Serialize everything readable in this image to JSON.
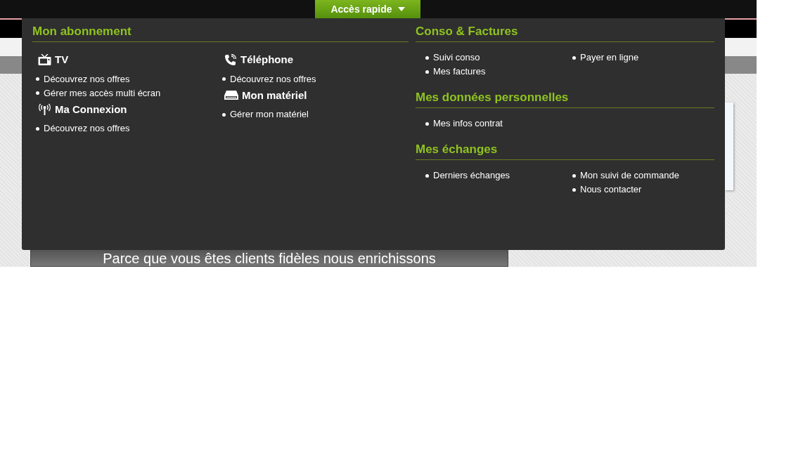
{
  "quick_access": {
    "label": "Accès rapide"
  },
  "subscription": {
    "title": "Mon abonnement",
    "columns": [
      [
        {
          "kind": "tv",
          "title": "TV",
          "links": [
            "Découvrez nos offres",
            "Gérer mes accès multi écran"
          ]
        },
        {
          "kind": "antenna",
          "title": "Ma Connexion",
          "links": [
            "Découvrez nos offres"
          ]
        }
      ],
      [
        {
          "kind": "phone",
          "title": "Téléphone",
          "links": [
            "Découvrez nos offres"
          ]
        },
        {
          "kind": "drive",
          "title": "Mon matériel",
          "links": [
            "Gérer mon matériel"
          ]
        }
      ]
    ]
  },
  "sections": [
    {
      "title": "Conso & Factures",
      "columns": [
        [
          "Suivi conso",
          "Mes factures"
        ],
        [
          "Payer en ligne"
        ]
      ]
    },
    {
      "title": "Mes données personnelles",
      "columns": [
        [
          "Mes infos contrat"
        ]
      ]
    },
    {
      "title": "Mes échanges",
      "columns": [
        [
          "Derniers échanges"
        ],
        [
          "Mon suivi de commande",
          "Nous contacter"
        ]
      ]
    }
  ],
  "banner": {
    "text": "Parce que vous êtes clients fidèles nous enrichissons"
  }
}
